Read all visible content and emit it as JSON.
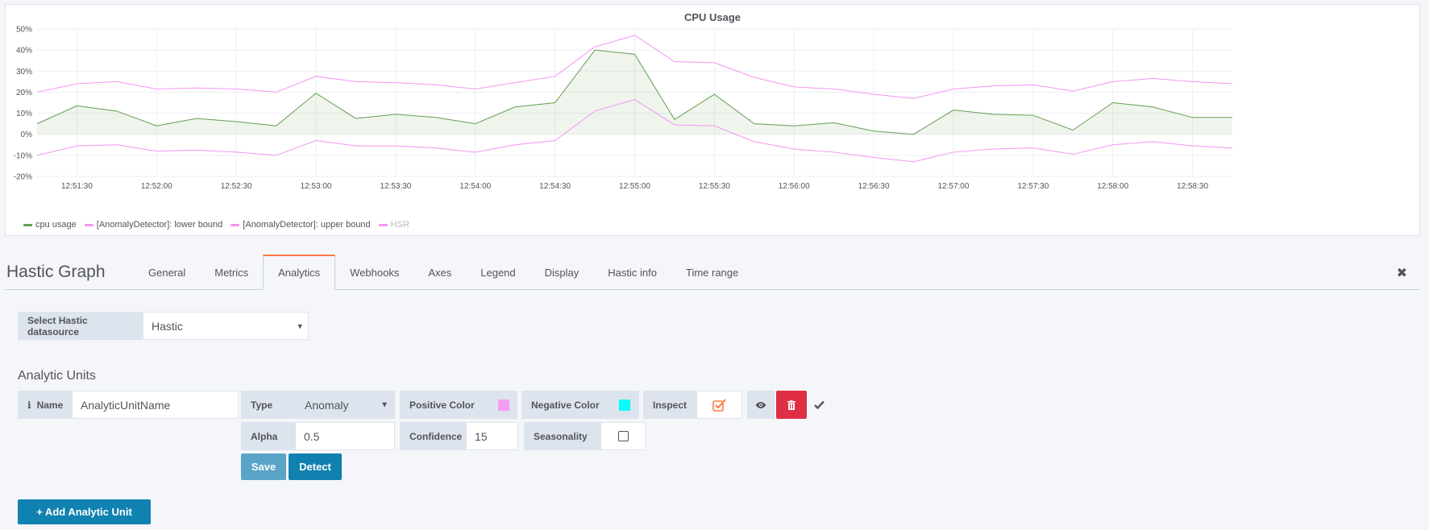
{
  "panel": {
    "title": "CPU Usage"
  },
  "chart_data": {
    "type": "line",
    "title": "CPU Usage",
    "ylim": [
      -20,
      50
    ],
    "y_ticks": [
      "50%",
      "40%",
      "30%",
      "20%",
      "10%",
      "0%",
      "-10%",
      "-20%"
    ],
    "x_ticks": [
      "12:51:30",
      "12:52:00",
      "12:52:30",
      "12:53:00",
      "12:53:30",
      "12:54:00",
      "12:54:30",
      "12:55:00",
      "12:55:30",
      "12:56:00",
      "12:56:30",
      "12:57:00",
      "12:57:30",
      "12:58:00",
      "12:58:30"
    ],
    "x": [
      "12:51:15",
      "12:51:30",
      "12:51:45",
      "12:52:00",
      "12:52:15",
      "12:52:30",
      "12:52:45",
      "12:53:00",
      "12:53:15",
      "12:53:30",
      "12:53:45",
      "12:54:00",
      "12:54:15",
      "12:54:30",
      "12:54:45",
      "12:55:00",
      "12:55:15",
      "12:55:30",
      "12:55:45",
      "12:56:00",
      "12:56:15",
      "12:56:30",
      "12:56:45",
      "12:57:00",
      "12:57:15",
      "12:57:30",
      "12:57:45",
      "12:58:00",
      "12:58:15",
      "12:58:30",
      "12:58:45"
    ],
    "grid": true,
    "legend": "bottom-left",
    "series": [
      {
        "name": "cpu usage",
        "color": "#629e51",
        "fill": true,
        "values": [
          5,
          13.5,
          11,
          4,
          7.5,
          6,
          4,
          19.5,
          7.5,
          9.5,
          8,
          5,
          13,
          15,
          40,
          38,
          7,
          19,
          5,
          4,
          5.5,
          1.5,
          0,
          11.5,
          9.5,
          9,
          2,
          15,
          13,
          8,
          8
        ]
      },
      {
        "name": "[AnomalyDetector]: lower bound",
        "color": "#f495f4",
        "values": [
          -10,
          -5.5,
          -5,
          -8,
          -7.5,
          -8.5,
          -10,
          -3,
          -5.5,
          -5.5,
          -6.5,
          -8.5,
          -5,
          -3,
          11,
          16.5,
          4.5,
          4,
          -3.5,
          -7,
          -8.5,
          -11,
          -13,
          -8.5,
          -7,
          -6.5,
          -9.5,
          -5,
          -3.5,
          -5.5,
          -6.5
        ]
      },
      {
        "name": "[AnomalyDetector]: upper bound",
        "color": "#f495f4",
        "values": [
          20,
          24,
          25,
          21.5,
          22,
          21.5,
          20,
          27.5,
          25,
          24.5,
          23.5,
          21.5,
          24.5,
          27.5,
          41.5,
          47,
          34.5,
          34,
          27,
          22.5,
          21.5,
          19,
          17,
          21.5,
          23,
          23.5,
          20.5,
          25,
          26.5,
          25,
          24
        ]
      },
      {
        "name": "HSR",
        "color": "#f495f4",
        "values": [],
        "dim": true
      }
    ]
  },
  "editor": {
    "title": "Hastic Graph",
    "tabs": [
      "General",
      "Metrics",
      "Analytics",
      "Webhooks",
      "Axes",
      "Legend",
      "Display",
      "Hastic info",
      "Time range"
    ],
    "active_tab": "Analytics",
    "close_icon": "✖"
  },
  "datasource": {
    "label": "Select Hastic datasource",
    "value": "Hastic"
  },
  "analytic_units": {
    "section_title": "Analytic Units",
    "info_icon": "ℹ",
    "name_label": "Name",
    "name_value": "AnalyticUnitName",
    "type_label": "Type",
    "type_value": "Anomaly",
    "positive_color_label": "Positive Color",
    "positive_color": "#f49cf4",
    "negative_color_label": "Negative Color",
    "negative_color": "#00ffff",
    "inspect_label": "Inspect",
    "inspect_checked": true,
    "alpha_label": "Alpha",
    "alpha_value": "0.5",
    "confidence_label": "Confidence",
    "confidence_value": "15",
    "seasonality_label": "Seasonality",
    "seasonality_checked": false,
    "save_label": "Save",
    "detect_label": "Detect",
    "add_label": "+ Add Analytic Unit"
  },
  "colors": {
    "accent": "#ff7941",
    "danger": "#e02f44",
    "primary": "#1082b1"
  }
}
